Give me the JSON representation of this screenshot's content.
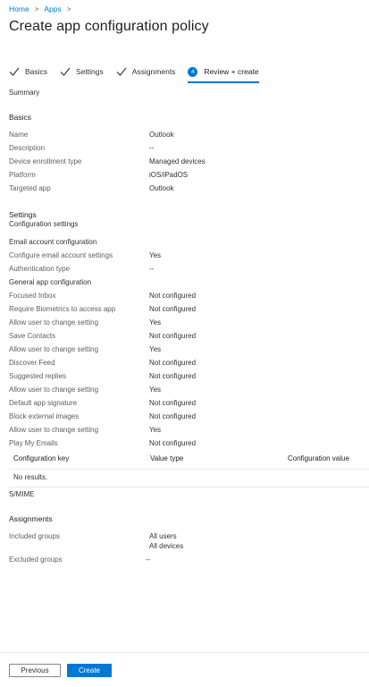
{
  "breadcrumb": {
    "home": "Home",
    "apps": "Apps",
    "separator": ">"
  },
  "page_title": "Create app configuration policy",
  "wizard": {
    "steps": [
      {
        "label": "Basics"
      },
      {
        "label": "Settings"
      },
      {
        "label": "Assignments"
      },
      {
        "label": "Review + create",
        "number": "4"
      }
    ]
  },
  "summary_label": "Summary",
  "basics": {
    "heading": "Basics",
    "rows": [
      {
        "label": "Name",
        "value": "Outlook"
      },
      {
        "label": "Description",
        "value": "--"
      },
      {
        "label": "Device enrollment type",
        "value": "Managed devices"
      },
      {
        "label": "Platform",
        "value": "iOS/iPadOS"
      },
      {
        "label": "Targeted app",
        "value": "Outlook"
      }
    ]
  },
  "settings": {
    "heading": "Settings",
    "subheading": "Configuration settings",
    "email_heading": "Email account configuration",
    "email_rows": [
      {
        "label": "Configure email account settings",
        "value": "Yes"
      },
      {
        "label": "Authentication type",
        "value": "--"
      }
    ],
    "general_heading": "General app configuration",
    "general_rows": [
      {
        "label": "Focused Inbox",
        "value": "Not configured"
      },
      {
        "label": "Require Biometrics to access app",
        "value": "Not configured"
      },
      {
        "label": "Allow user to change setting",
        "value": "Yes"
      },
      {
        "label": "Save Contacts",
        "value": "Not configured"
      },
      {
        "label": "Allow user to change setting",
        "value": "Yes"
      },
      {
        "label": "Discover Feed",
        "value": "Not configured"
      },
      {
        "label": "Suggested replies",
        "value": "Not configured"
      },
      {
        "label": "Allow user to change setting",
        "value": "Yes"
      },
      {
        "label": "Default app signature",
        "value": "Not configured"
      },
      {
        "label": "Block external images",
        "value": "Not configured"
      },
      {
        "label": "Allow user to change setting",
        "value": "Yes"
      },
      {
        "label": "Play My Emails",
        "value": "Not configured"
      }
    ],
    "table": {
      "columns": [
        "Configuration key",
        "Value type",
        "Configuration value"
      ],
      "empty": "No results."
    },
    "smime_label": "S/MIME"
  },
  "assignments": {
    "heading": "Assignments",
    "included_label": "Included groups",
    "included_values": [
      "All users",
      "All devices"
    ],
    "excluded_label": "Excluded groups",
    "excluded_value": "--"
  },
  "footer": {
    "previous": "Previous",
    "create": "Create"
  },
  "colors": {
    "accent": "#0078d4",
    "text": "#323130",
    "muted": "#605e5c"
  }
}
